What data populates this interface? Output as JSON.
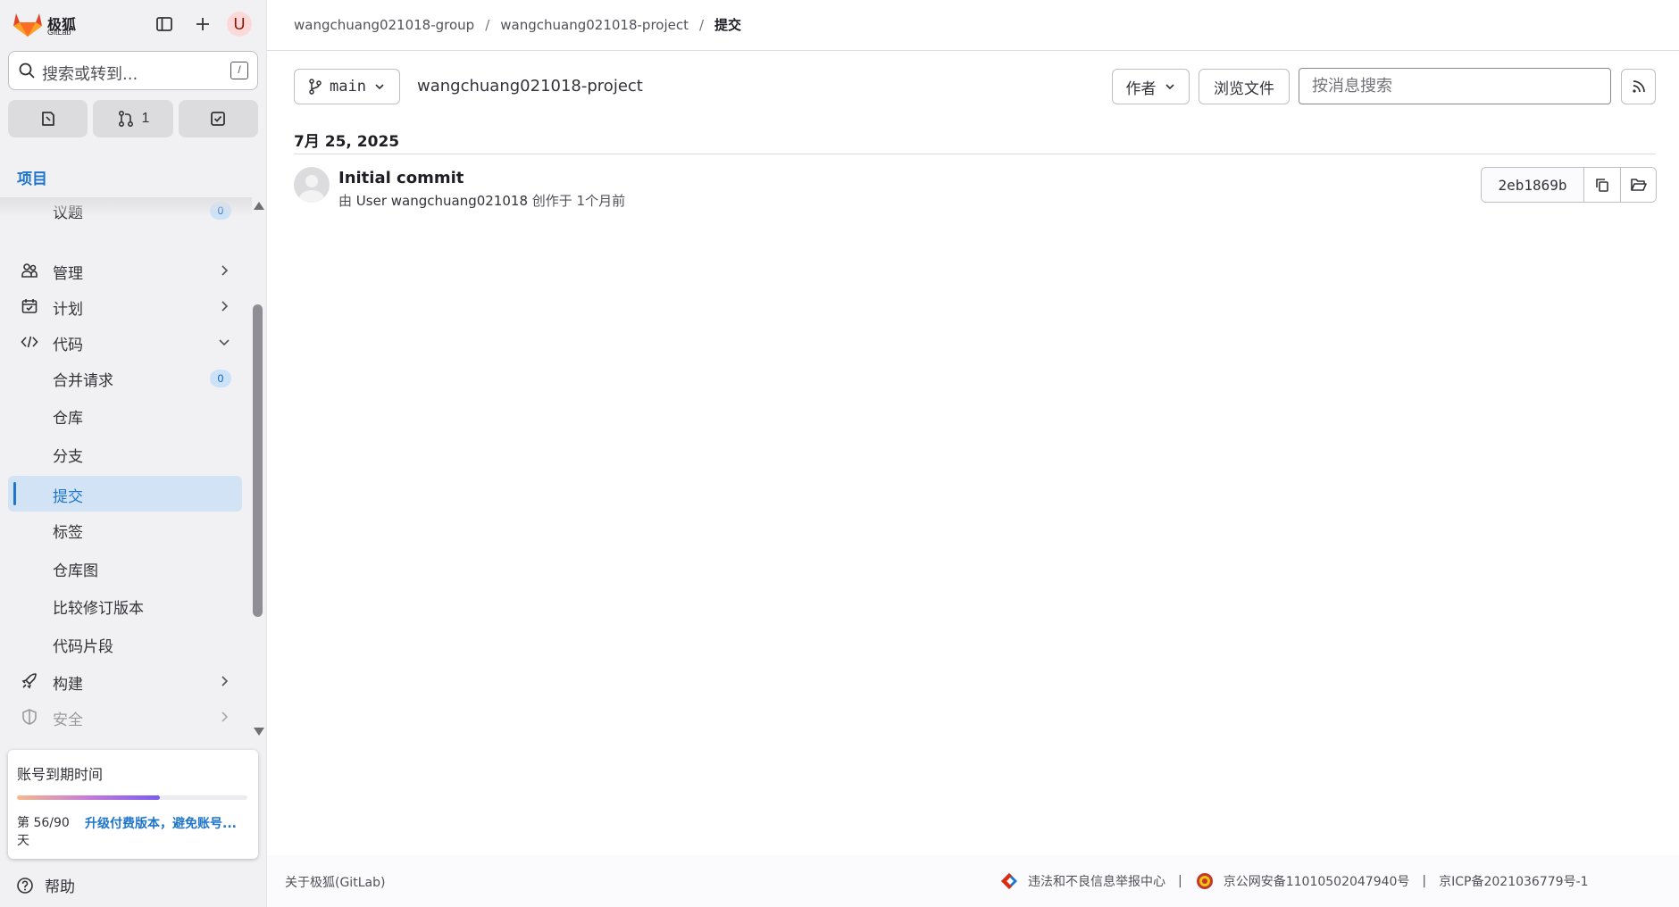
{
  "brand": {
    "name": "极狐",
    "sub": "GitLab"
  },
  "user": {
    "initial": "U"
  },
  "search": {
    "placeholder": "搜索或转到...",
    "shortcut": "/"
  },
  "counters": {
    "merge_requests": "1"
  },
  "sidebar": {
    "section_title": "项目",
    "items": [
      {
        "label": "议题",
        "badge": "0"
      },
      {
        "label": "管理"
      },
      {
        "label": "计划"
      },
      {
        "label": "代码"
      },
      {
        "label": "合并请求",
        "badge": "0"
      },
      {
        "label": "仓库"
      },
      {
        "label": "分支"
      },
      {
        "label": "提交"
      },
      {
        "label": "标签"
      },
      {
        "label": "仓库图"
      },
      {
        "label": "比较修订版本"
      },
      {
        "label": "代码片段"
      },
      {
        "label": "构建"
      },
      {
        "label": "安全"
      }
    ],
    "trial": {
      "title": "账号到期时间",
      "days": "第 56/90 天",
      "progress": 0.62,
      "upgrade": "升级付费版本，避免账号..."
    },
    "help": "帮助"
  },
  "breadcrumb": [
    "wangchuang021018-group",
    "wangchuang021018-project",
    "提交"
  ],
  "toolbar": {
    "branch": "main",
    "project": "wangchuang021018-project",
    "author": "作者",
    "browse": "浏览文件",
    "search_placeholder": "按消息搜索"
  },
  "commits": {
    "date": "7月 25, 2025",
    "items": [
      {
        "title": "Initial commit",
        "meta_prefix": "由",
        "author": "User wangchuang021018",
        "meta_suffix": "创作于 1个月前",
        "sha": "2eb1869b"
      }
    ]
  },
  "footer": {
    "about": "关于极狐(GitLab)",
    "report": "违法和不良信息举报中心",
    "police": "京公网安备11010502047940号",
    "icp": "京ICP备2021036779号-1"
  }
}
